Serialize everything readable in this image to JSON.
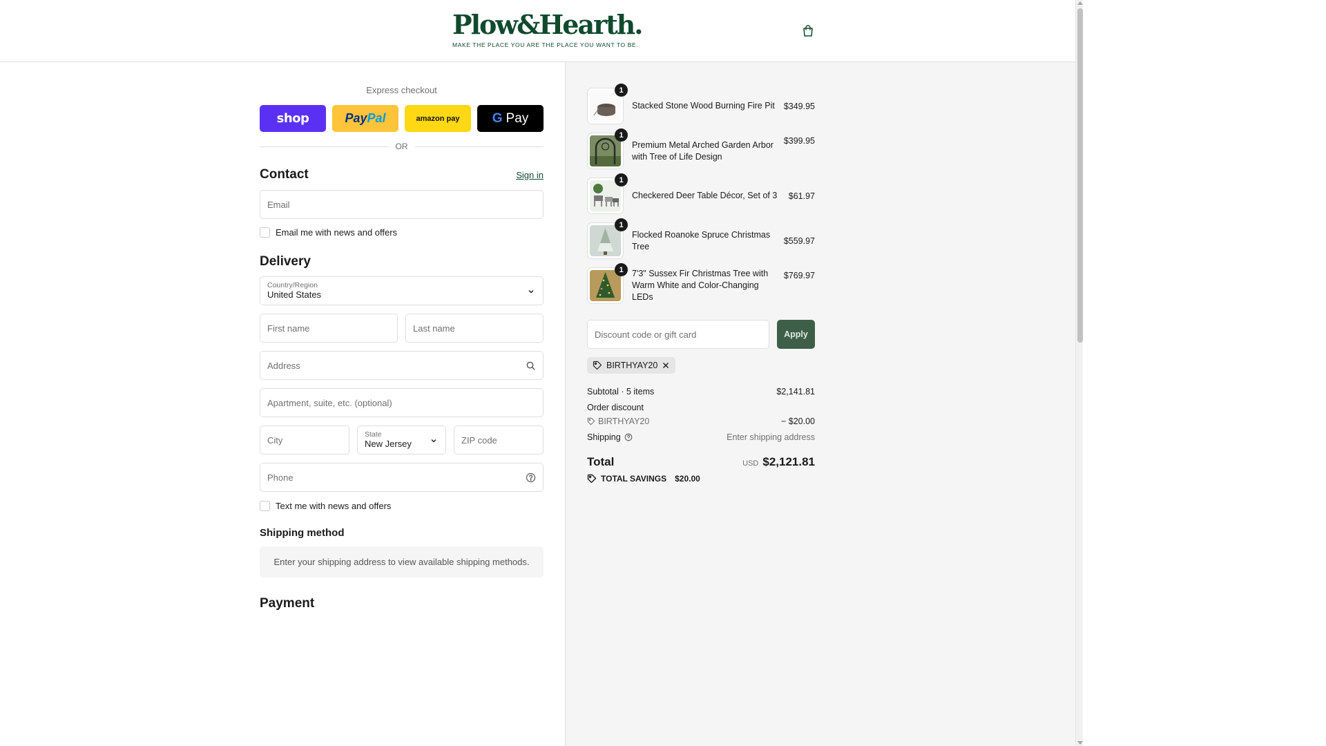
{
  "brand": {
    "name": "Plow&Hearth.",
    "tagline": "MAKE THE PLACE YOU ARE THE PLACE YOU WANT TO BE."
  },
  "express": {
    "title": "Express checkout",
    "shop_label": "shop",
    "paypal_label_1": "Pay",
    "paypal_label_2": "Pal",
    "amazon_label": "amazon pay",
    "gpay_g": "G",
    "gpay_label": "Pay",
    "or_label": "OR"
  },
  "contact": {
    "title": "Contact",
    "signin_label": "Sign in",
    "email_placeholder": "Email",
    "news_label": "Email me with news and offers"
  },
  "delivery": {
    "title": "Delivery",
    "country_label": "Country/Region",
    "country_value": "United States",
    "first_name_placeholder": "First name",
    "last_name_placeholder": "Last name",
    "address_placeholder": "Address",
    "apartment_placeholder": "Apartment, suite, etc. (optional)",
    "city_placeholder": "City",
    "state_label": "State",
    "state_value": "New Jersey",
    "zip_placeholder": "ZIP code",
    "phone_placeholder": "Phone",
    "text_label": "Text me with news and offers"
  },
  "shipping_method": {
    "title": "Shipping method",
    "notice": "Enter your shipping address to view available shipping methods."
  },
  "payment": {
    "title": "Payment"
  },
  "summary": {
    "items": [
      {
        "qty": "1",
        "name": "Stacked Stone Wood Burning Fire Pit",
        "price": "$349.95",
        "image": "fire-pit"
      },
      {
        "qty": "1",
        "name": "Premium Metal Arched Garden Arbor with Tree of Life Design",
        "price": "$399.95",
        "image": "garden-arbor"
      },
      {
        "qty": "1",
        "name": "Checkered Deer Table Décor, Set of 3",
        "price": "$61.97",
        "image": "deer-decor"
      },
      {
        "qty": "1",
        "name": "Flocked Roanoke Spruce Christmas Tree",
        "price": "$559.97",
        "image": "flocked-tree"
      },
      {
        "qty": "1",
        "name": "7'3\" Sussex Fir Christmas Tree with Warm White and Color-Changing LEDs",
        "price": "$769.97",
        "image": "lit-tree"
      }
    ],
    "discount_placeholder": "Discount code or gift card",
    "apply_label": "Apply",
    "applied_code": "BIRTHYAY20",
    "subtotal_label": "Subtotal · 5 items",
    "subtotal_value": "$2,141.81",
    "order_discount_label": "Order discount",
    "discount_code": "BIRTHYAY20",
    "discount_value": "− $20.00",
    "shipping_label": "Shipping",
    "shipping_value": "Enter shipping address",
    "total_label": "Total",
    "total_currency": "USD",
    "total_value": "$2,121.81",
    "savings_label": "TOTAL SAVINGS",
    "savings_value": "$20.00"
  },
  "colors": {
    "brand_green": "#0f4a2d",
    "apply_green": "#3d5f47",
    "shop_purple": "#5a31f4",
    "paypal_yellow": "#ffc439",
    "amazon_yellow": "#ffd814"
  }
}
